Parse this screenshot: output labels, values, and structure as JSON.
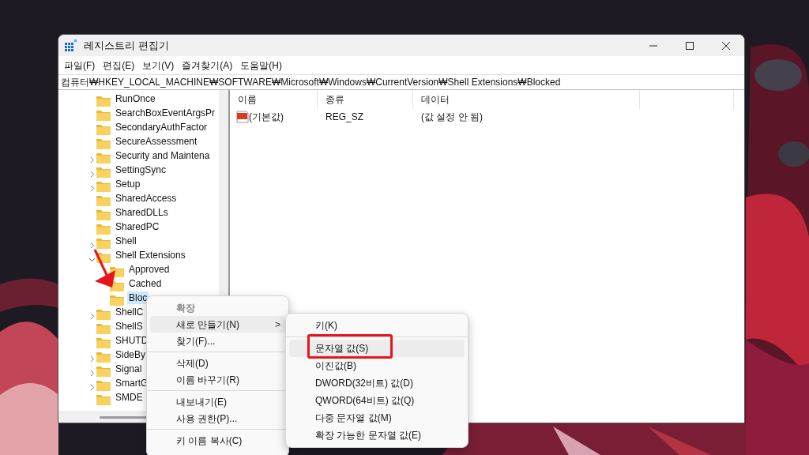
{
  "window": {
    "title": "레지스트리 편집기"
  },
  "menu_bar": [
    "파일(F)",
    "편집(E)",
    "보기(V)",
    "즐겨찾기(A)",
    "도움말(H)"
  ],
  "address": "컴퓨터₩HKEY_LOCAL_MACHINE₩SOFTWARE₩Microsoft₩Windows₩CurrentVersion₩Shell Extensions₩Blocked",
  "tree": {
    "items": [
      {
        "label": "RunOnce",
        "selected": false
      },
      {
        "label": "SearchBoxEventArgsPr",
        "selected": false
      },
      {
        "label": "SecondaryAuthFactor",
        "selected": false
      },
      {
        "label": "SecureAssessment",
        "selected": false
      },
      {
        "label": "Security and Maintena",
        "expanded": false,
        "selected": false
      },
      {
        "label": "SettingSync",
        "expanded": false,
        "selected": false
      },
      {
        "label": "Setup",
        "expanded": false,
        "selected": false
      },
      {
        "label": "SharedAccess",
        "selected": false
      },
      {
        "label": "SharedDLLs",
        "selected": false
      },
      {
        "label": "SharedPC",
        "selected": false
      },
      {
        "label": "Shell",
        "expanded": false,
        "selected": false
      },
      {
        "label": "Shell Extensions",
        "expanded": true,
        "selected": false,
        "children": [
          {
            "label": "Approved",
            "selected": false
          },
          {
            "label": "Cached",
            "selected": false
          },
          {
            "label": "Bloc",
            "selected": true
          }
        ]
      },
      {
        "label": "ShellC",
        "expanded": false,
        "selected": false
      },
      {
        "label": "ShellS",
        "selected": false
      },
      {
        "label": "SHUTD",
        "selected": false
      },
      {
        "label": "SideBy",
        "expanded": false,
        "selected": false
      },
      {
        "label": "Signal",
        "expanded": false,
        "selected": false
      },
      {
        "label": "SmartG",
        "expanded": false,
        "selected": false
      },
      {
        "label": "SMDE",
        "selected": false
      }
    ]
  },
  "values": {
    "columns": [
      "이름",
      "종류",
      "데이터"
    ],
    "rows": [
      {
        "name": "(기본값)",
        "type": "REG_SZ",
        "data": "(값 설정 안 됨)"
      }
    ]
  },
  "context_menu": {
    "items": [
      {
        "kind": "header",
        "label": "확장",
        "selected": false
      },
      {
        "kind": "submenu",
        "label": "새로 만들기(N)",
        "arrow": ">",
        "selected": true
      },
      {
        "kind": "item",
        "label": "찾기(F)...",
        "selected": false
      },
      {
        "kind": "separator"
      },
      {
        "kind": "item",
        "label": "삭제(D)",
        "selected": false
      },
      {
        "kind": "item",
        "label": "이름 바꾸기(R)",
        "selected": false
      },
      {
        "kind": "separator"
      },
      {
        "kind": "item",
        "label": "내보내기(E)",
        "selected": false
      },
      {
        "kind": "item",
        "label": "사용 권한(P)...",
        "selected": false
      },
      {
        "kind": "separator"
      },
      {
        "kind": "item",
        "label": "키 이름 복사(C)",
        "selected": false
      }
    ]
  },
  "submenu": {
    "items": [
      {
        "kind": "item",
        "label": "키(K)",
        "selected": false
      },
      {
        "kind": "separator"
      },
      {
        "kind": "item",
        "label": "문자열 값(S)",
        "selected": true
      },
      {
        "kind": "item",
        "label": "이진값(B)",
        "selected": false
      },
      {
        "kind": "item",
        "label": "DWORD(32비트) 값(D)",
        "selected": false
      },
      {
        "kind": "item",
        "label": "QWORD(64비트) 값(Q)",
        "selected": false
      },
      {
        "kind": "item",
        "label": "다중 문자열 값(M)",
        "selected": false
      },
      {
        "kind": "item",
        "label": "확장 가능한 문자열 값(E)",
        "selected": false
      }
    ]
  }
}
